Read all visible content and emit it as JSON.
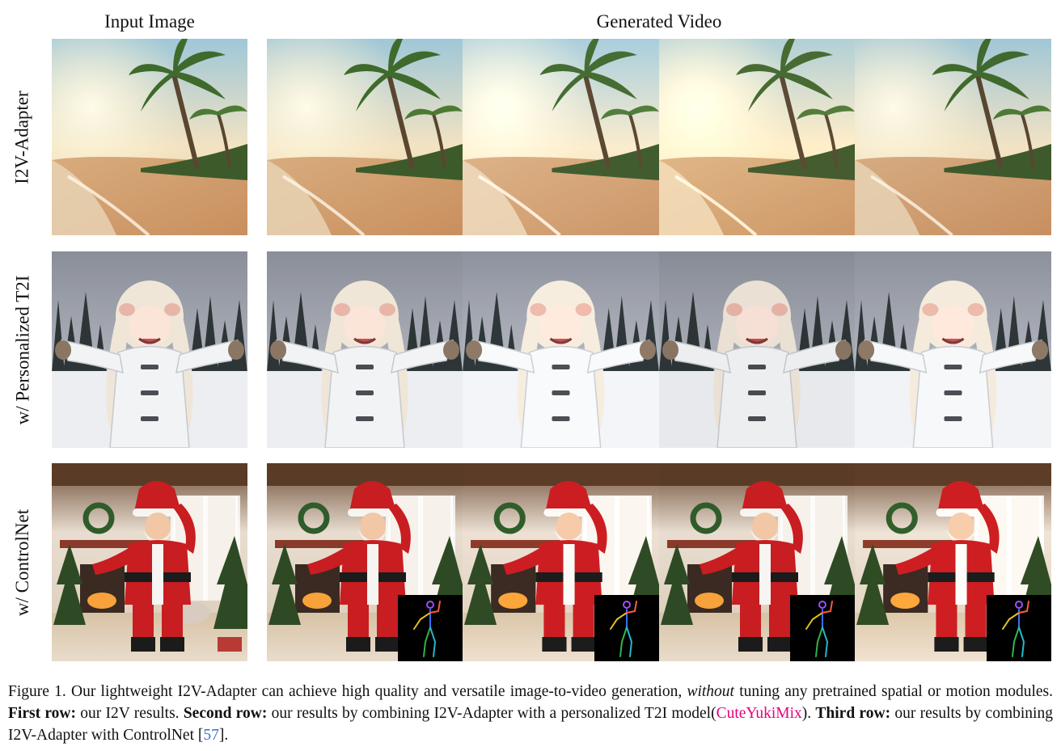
{
  "header": {
    "input": "Input Image",
    "generated": "Generated Video"
  },
  "rows": [
    {
      "label": "I2V-Adapter",
      "scene": "beach"
    },
    {
      "label": "w/ Personalized T2I",
      "scene": "snow-girl"
    },
    {
      "label": "w/  ControlNet",
      "scene": "santa"
    }
  ],
  "caption": {
    "p1": "Figure 1. Our lightweight I2V-Adapter can achieve high quality and versatile image-to-video generation, ",
    "em": "without",
    "p2": " tuning any pretrained spatial or motion modules. ",
    "b1": "First row:",
    "p3": " our I2V results. ",
    "b2": "Second row:",
    "p4": " our results by combining I2V-Adapter with a personalized T2I model(",
    "link": "CuteYukiMix",
    "p5": "). ",
    "b3": "Third row:",
    "p6": " our results by combining I2V-Adapter with ControlNet [",
    "cite": "57",
    "p7": "]."
  },
  "colors": {
    "link": "#e6007e",
    "cite": "#3b6fd6"
  }
}
